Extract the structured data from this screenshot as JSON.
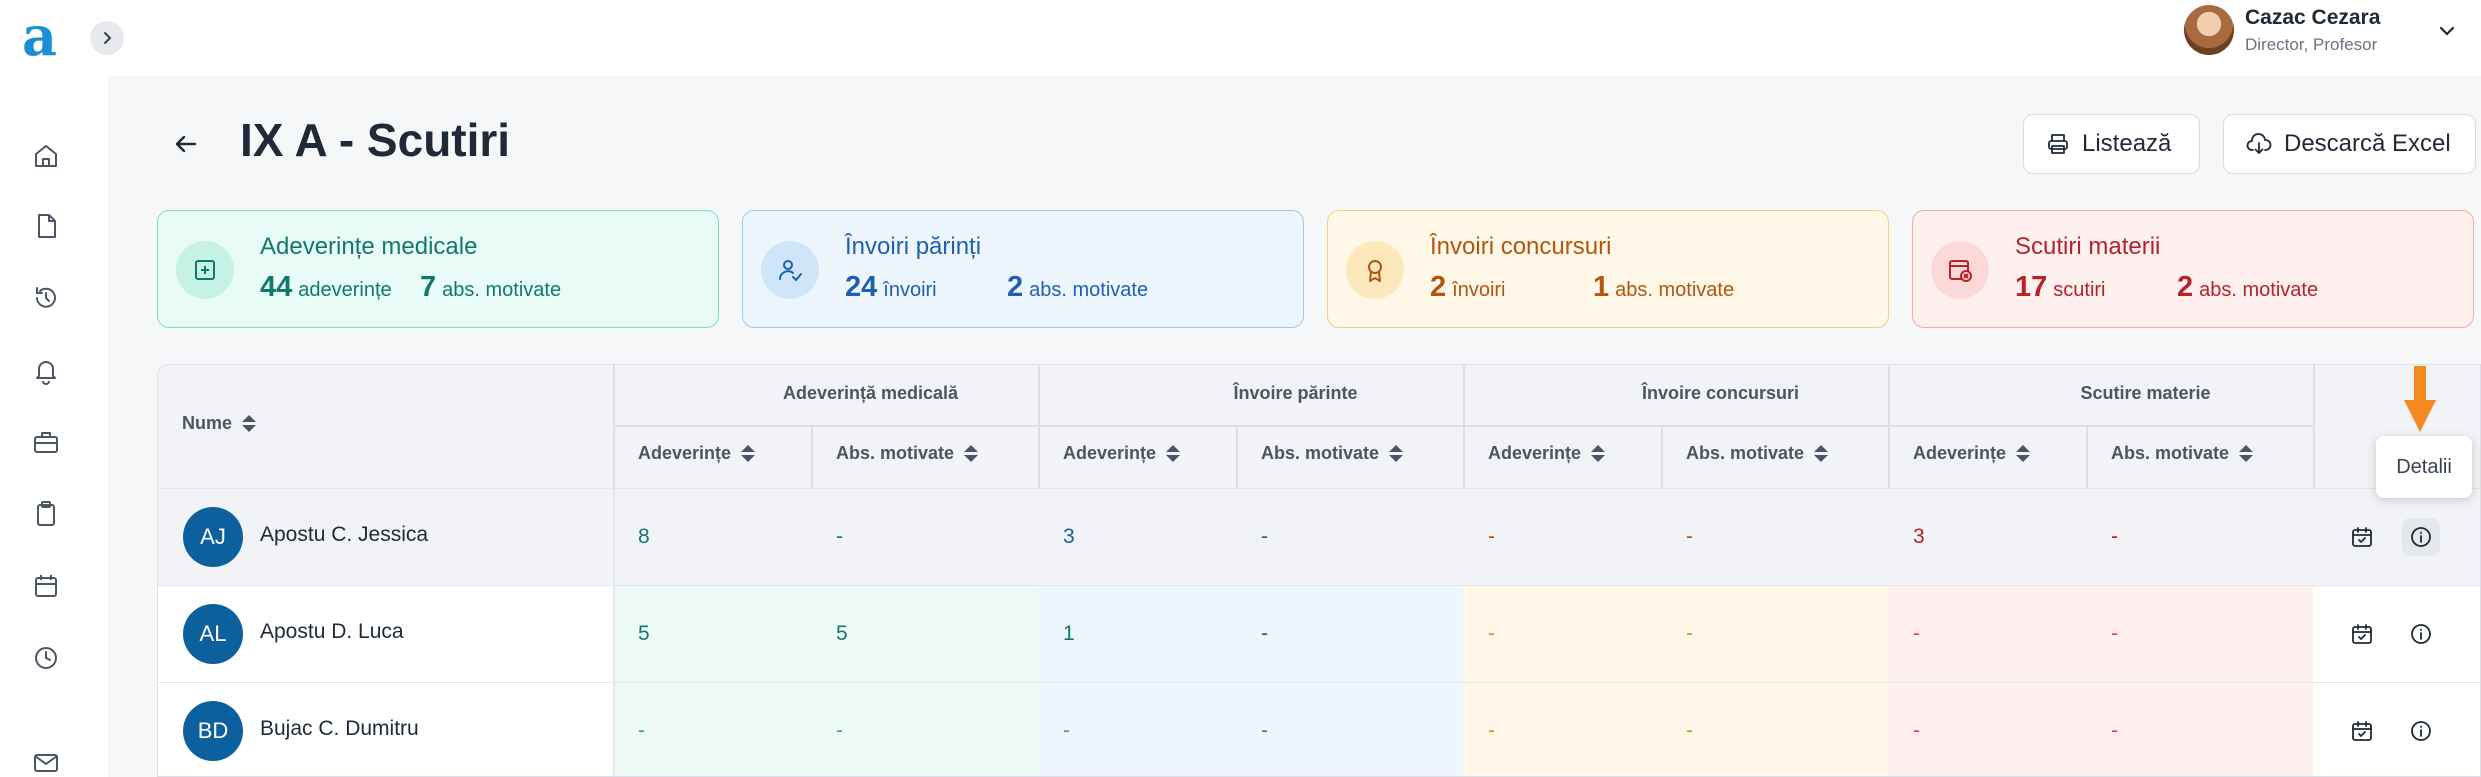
{
  "app": {
    "logo": "a"
  },
  "user": {
    "name": "Cazac Cezara",
    "role": "Director, Profesor"
  },
  "sidebar": {
    "icons": [
      "home-icon",
      "document-icon",
      "history-icon",
      "bell-icon",
      "briefcase-icon",
      "clipboard-icon",
      "calendar-icon",
      "clock-icon",
      "mail-icon"
    ]
  },
  "header": {
    "title": "IX A - Scutiri",
    "print_label": "Listează",
    "excel_label": "Descarcă Excel"
  },
  "cards": [
    {
      "title": "Adeverințe medicale",
      "n1": "44",
      "l1": "adeverințe",
      "n2": "7",
      "l2": "abs. motivate",
      "color": "#0f7a6c",
      "bg": "#e9fbf6",
      "border": "#7fdcc6",
      "iconbg": "#c6f2e5",
      "icon": "plus-box-icon"
    },
    {
      "title": "Învoiri părinți",
      "n1": "24",
      "l1": "învoiri",
      "n2": "2",
      "l2": "abs. motivate",
      "color": "#1f5fb3",
      "bg": "#eef6fd",
      "border": "#9ccbef",
      "iconbg": "#cfe6fa",
      "icon": "user-check-icon"
    },
    {
      "title": "Învoiri concursuri",
      "n1": "2",
      "l1": "învoiri",
      "n2": "1",
      "l2": "abs. motivate",
      "color": "#b0560e",
      "bg": "#fff7e8",
      "border": "#f6cf7a",
      "iconbg": "#fde8bb",
      "icon": "award-icon"
    },
    {
      "title": "Scutiri materii",
      "n1": "17",
      "l1": "scutiri",
      "n2": "2",
      "l2": "abs. motivate",
      "color": "#b4232a",
      "bg": "#fff0f0",
      "border": "#f4a9ab",
      "iconbg": "#fcd8d9",
      "icon": "calendar-x-icon"
    }
  ],
  "table": {
    "name_header": "Nume",
    "groups": [
      "Adeverință medicală",
      "Învoire părinte",
      "Învoire concursuri",
      "Scutire materie"
    ],
    "sub_headers": [
      "Adeverințe",
      "Abs. motivate",
      "Adeverințe",
      "Abs. motivate",
      "Adeverințe",
      "Abs. motivate",
      "Adeverințe",
      "Abs. motivate"
    ],
    "rows": [
      {
        "initials": "AJ",
        "name": "Apostu C. Jessica",
        "values": [
          "8",
          "-",
          "3",
          "-",
          "-",
          "-",
          "3",
          "-"
        ]
      },
      {
        "initials": "AL",
        "name": "Apostu D. Luca",
        "values": [
          "5",
          "5",
          "1",
          "-",
          "-",
          "-",
          "-",
          "-"
        ]
      },
      {
        "initials": "BD",
        "name": "Bujac C. Dumitru",
        "values": [
          "-",
          "-",
          "-",
          "-",
          "-",
          "-",
          "-",
          "-"
        ]
      }
    ]
  },
  "tooltip": {
    "label": "Detalii"
  },
  "colors": {
    "medical": "#0f7a6c",
    "parents": "#1f5fb3",
    "contests": "#b0560e",
    "exempt": "#b4232a",
    "accent_arrow": "#f28a1f"
  }
}
